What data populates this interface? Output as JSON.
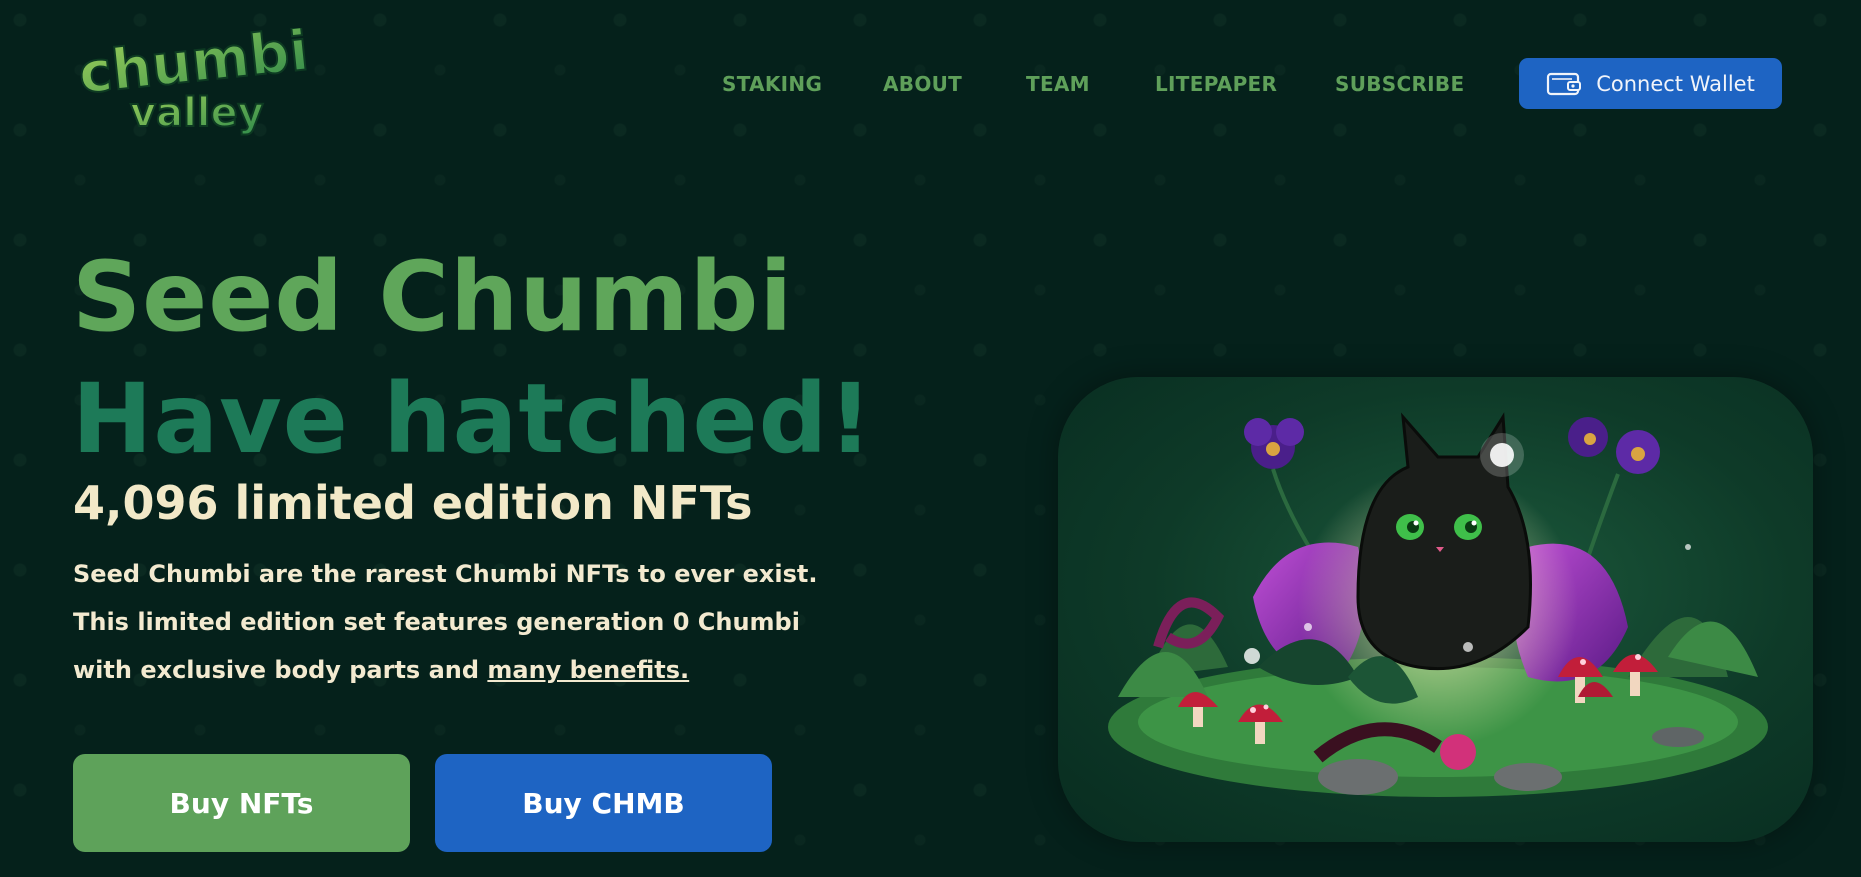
{
  "header": {
    "logo_text_line1": "chumbi",
    "logo_text_line2": "valley",
    "nav": [
      {
        "label": "STAKING"
      },
      {
        "label": "ABOUT"
      },
      {
        "label": "TEAM"
      },
      {
        "label": "LITEPAPER"
      },
      {
        "label": "SUBSCRIBE"
      }
    ],
    "connect_label": "Connect Wallet"
  },
  "hero": {
    "title_line1": "Seed Chumbi",
    "title_line2": "Have hatched!",
    "subtitle": "4,096 limited edition NFTs",
    "desc_line1": "Seed Chumbi are the rarest Chumbi NFTs to ever exist.",
    "desc_line2": "This limited edition set features generation 0 Chumbi",
    "desc_line3_prefix": "with exclusive body parts and ",
    "desc_link": "many benefits.",
    "buy_nfts": "Buy NFTs",
    "buy_chmb": "Buy CHMB"
  },
  "colors": {
    "background": "#05211b",
    "accent_green": "#5fa65a",
    "dark_green": "#1d7a58",
    "accent_blue": "#1e64c3",
    "cream": "#f2e9c8"
  },
  "icons": {
    "wallet": "wallet-icon",
    "illustration": "chumbi-hatching-illustration"
  }
}
